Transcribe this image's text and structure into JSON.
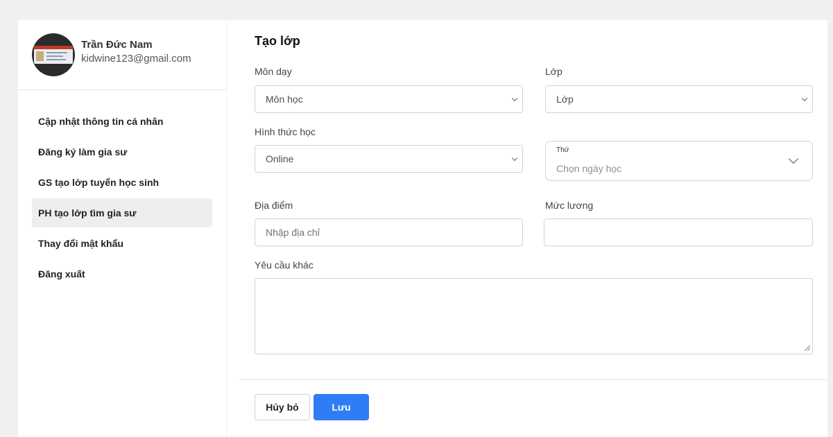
{
  "profile": {
    "name": "Trần Đức Nam",
    "email": "kidwine123@gmail.com"
  },
  "sidebar": {
    "items": [
      {
        "label": "Cập nhật thông tin cá nhân",
        "active": false
      },
      {
        "label": "Đăng ký làm gia sư",
        "active": false
      },
      {
        "label": "GS tạo lớp tuyển học sinh",
        "active": false
      },
      {
        "label": "PH tạo lớp tìm gia sư",
        "active": true
      },
      {
        "label": "Thay đổi mật khẩu",
        "active": false
      },
      {
        "label": "Đăng xuất",
        "active": false
      }
    ]
  },
  "form": {
    "title": "Tạo lớp",
    "subject": {
      "label": "Môn dạy",
      "value": "Môn học"
    },
    "grade": {
      "label": "Lớp",
      "value": "Lớp"
    },
    "mode": {
      "label": "Hình thức học",
      "value": "Online"
    },
    "days": {
      "label": "Thứ",
      "placeholder": "Chọn ngày học"
    },
    "location": {
      "label": "Địa điểm",
      "placeholder": "Nhập địa chỉ"
    },
    "salary": {
      "label": "Mức lương",
      "value": ""
    },
    "other": {
      "label": "Yêu cầu khác",
      "value": ""
    }
  },
  "actions": {
    "cancel_label": "Hủy bỏ",
    "save_label": "Lưu"
  },
  "colors": {
    "primary": "#2f7cf6",
    "background": "#f0f0f0",
    "active_item": "#eeeeee"
  }
}
